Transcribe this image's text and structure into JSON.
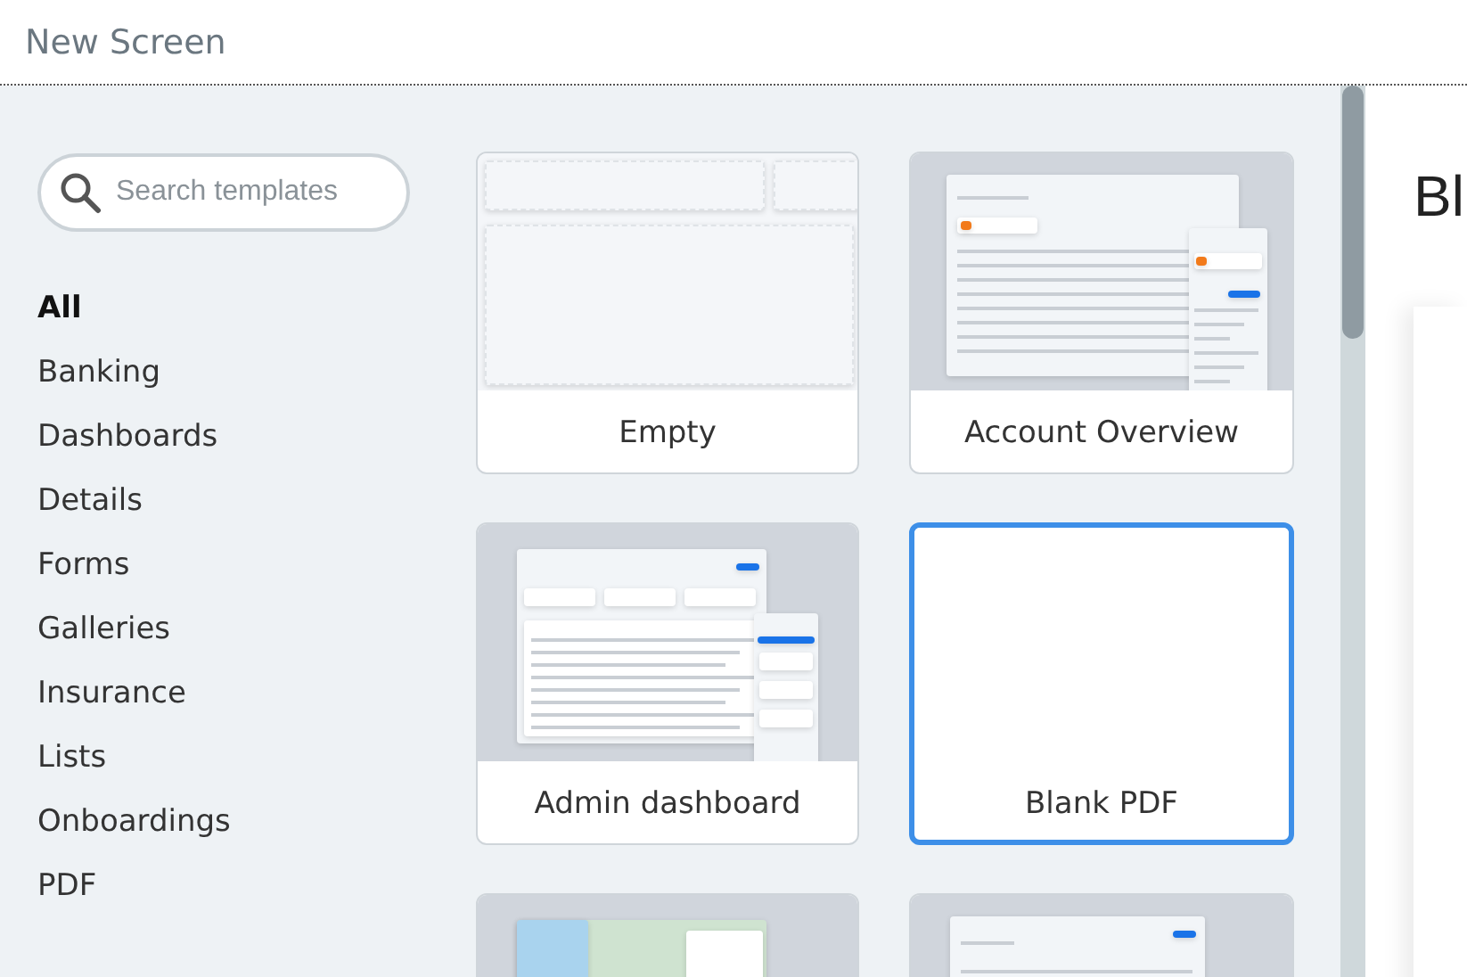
{
  "window": {
    "title": "New Screen"
  },
  "search": {
    "placeholder": "Search templates"
  },
  "categories": [
    {
      "label": "All",
      "selected": true
    },
    {
      "label": "Banking",
      "selected": false
    },
    {
      "label": "Dashboards",
      "selected": false
    },
    {
      "label": "Details",
      "selected": false
    },
    {
      "label": "Forms",
      "selected": false
    },
    {
      "label": "Galleries",
      "selected": false
    },
    {
      "label": "Insurance",
      "selected": false
    },
    {
      "label": "Lists",
      "selected": false
    },
    {
      "label": "Onboardings",
      "selected": false
    },
    {
      "label": "PDF",
      "selected": false
    }
  ],
  "templates": [
    {
      "kind": "empty",
      "label": "Empty",
      "selected": false
    },
    {
      "kind": "overview",
      "label": "Account Overview",
      "selected": false
    },
    {
      "kind": "dashboard",
      "label": "Admin dashboard",
      "selected": false
    },
    {
      "kind": "blank",
      "label": "Blank PDF",
      "selected": true
    },
    {
      "kind": "map",
      "selected": false
    },
    {
      "kind": "table",
      "selected": false
    }
  ],
  "preview": {
    "title": "Bl"
  }
}
